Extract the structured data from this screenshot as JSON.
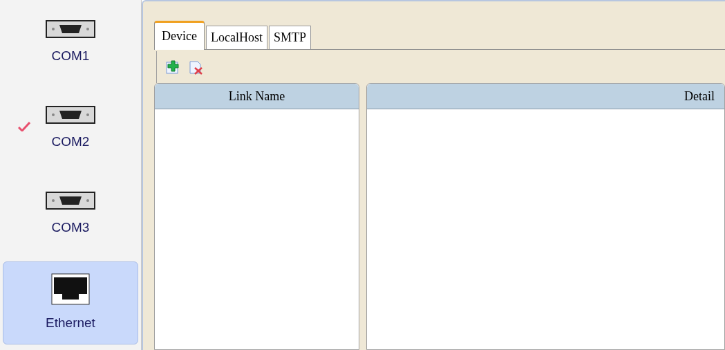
{
  "sidebar": {
    "items": [
      {
        "label": "COM1",
        "kind": "serial",
        "checked": false,
        "selected": false
      },
      {
        "label": "COM2",
        "kind": "serial",
        "checked": true,
        "selected": false
      },
      {
        "label": "COM3",
        "kind": "serial",
        "checked": false,
        "selected": false
      },
      {
        "label": "Ethernet",
        "kind": "ethernet",
        "checked": false,
        "selected": true
      }
    ]
  },
  "tabs": [
    {
      "label": "Device",
      "selected": true
    },
    {
      "label": "LocalHost",
      "selected": false
    },
    {
      "label": "SMTP",
      "selected": false
    }
  ],
  "table": {
    "columns": [
      "Link Name",
      "Detail"
    ]
  }
}
